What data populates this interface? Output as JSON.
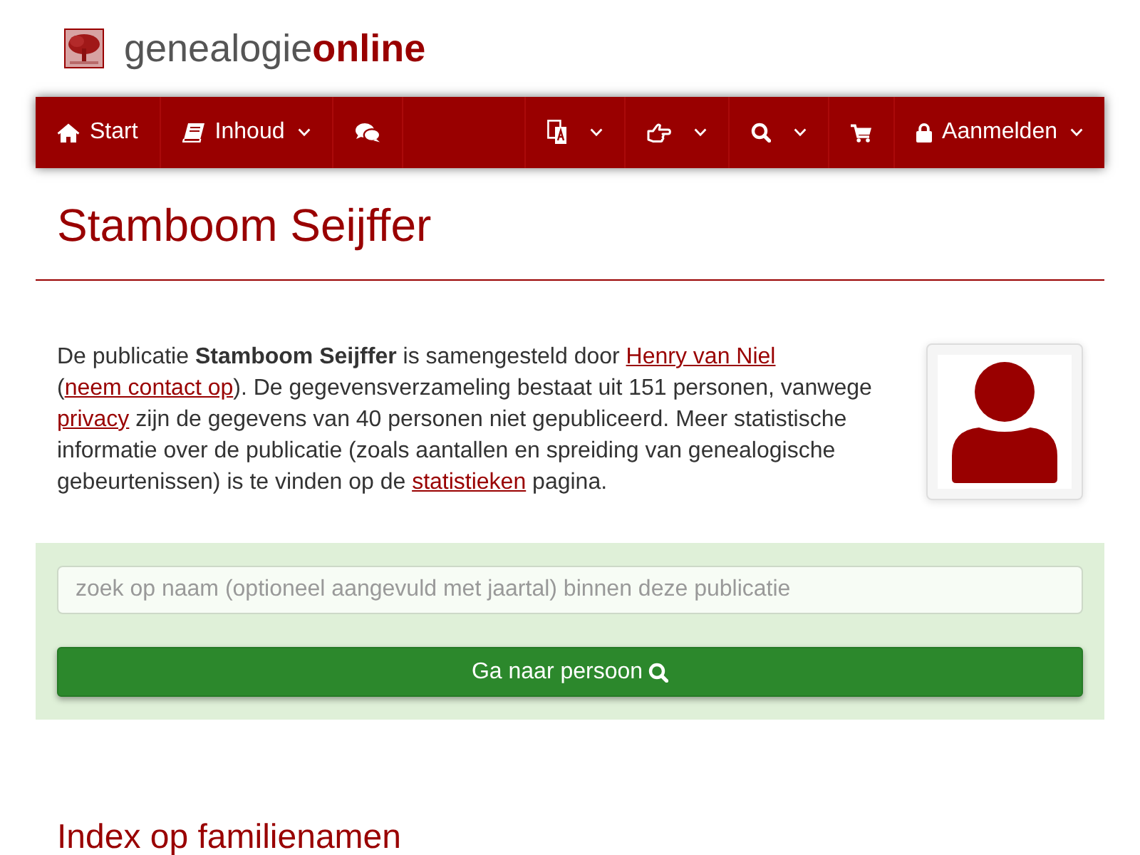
{
  "header": {
    "logo": "genealogie**online**"
  },
  "nav": {
    "left": [
      {
        "kind": "home",
        "label": "Start",
        "dropdown": false
      },
      {
        "kind": "book",
        "label": "Inhoud",
        "dropdown": true
      },
      {
        "kind": "chat",
        "dropdown": false
      }
    ],
    "right": [
      {
        "kind": "translate",
        "dropdown": true
      },
      {
        "kind": "hand",
        "dropdown": true
      },
      {
        "kind": "search",
        "dropdown": true
      },
      {
        "kind": "cart",
        "dropdown": false
      },
      {
        "kind": "lock",
        "label": "Aanmelden",
        "dropdown": true
      }
    ]
  },
  "publication": {
    "title": "Stamboom Seijffer",
    "intro": [
      {
        "kind": "text",
        "text": "De publicatie **Stamboom Seijffer** is samengesteld door "
      },
      {
        "kind": "link",
        "text": "Henry van Niel"
      },
      {
        "kind": "text",
        "text": " ("
      },
      {
        "kind": "link",
        "text": "neem contact op"
      },
      {
        "kind": "text",
        "text": "). De gegevensverzameling bestaat uit 151 personen, vanwege "
      },
      {
        "kind": "link",
        "text": "privacy"
      },
      {
        "kind": "text",
        "text": " zijn de gegevens van 40 personen niet gepubliceerd. Meer statistische informatie over de publicatie (zoals aantallen en spreiding van genealogische gebeurtenissen) is te vinden op de "
      },
      {
        "kind": "link",
        "text": "statistieken"
      },
      {
        "kind": "text",
        "text": " pagina."
      }
    ]
  },
  "search": {
    "placeholder": "zoek op naam (optioneel aangevuld met jaartal) binnen deze publicatie",
    "button": "Ga naar persoon"
  },
  "index": {
    "heading": "Index op familienamen"
  }
}
